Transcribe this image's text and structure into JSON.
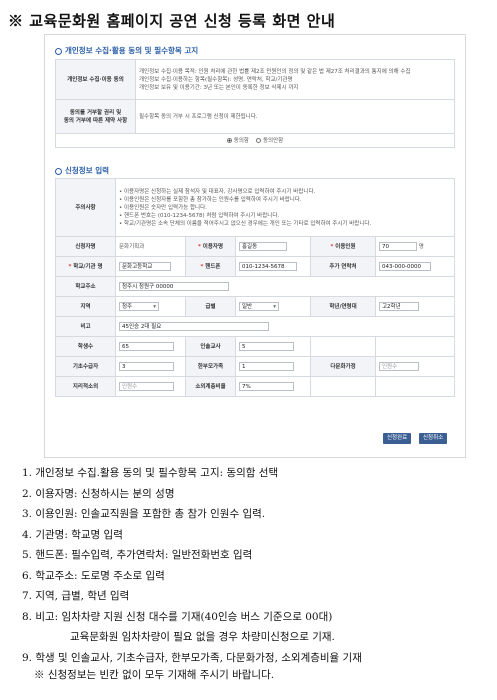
{
  "page_title": "※ 교육문화원 홈페이지 공연 신청 등록 화면 안내",
  "privacy": {
    "section_title": "개인정보 수집·활용 동의 및 필수항목 고지",
    "row1_label": "개인정보 수집·이용 동의",
    "row1_lines": [
      "개인정보 수집·이용 목적: 인원 처리에 관한 법률 제2조 민원인의 정의 및 같은 법 제27조 처리결과의 통지에 의해 수집",
      "개인정보 수집·이용하는 항목(필수항목): 성명, 연락처, 학교/기관명",
      "개인정보 보유 및 이용기간: 3년 또는 본인이 동록한 정보 삭제시 까지"
    ],
    "row2_label_1": "동의를 거부할 권리 및",
    "row2_label_2": "동의 거부에 따른 제약 사항",
    "row2_text": "필수항목 동의 거부 시 프로그램 신청이 제한됩니다.",
    "agree": "동의함",
    "disagree": "동의안함"
  },
  "apply": {
    "section_title": "신청정보 입력",
    "notice_label": "주의사항",
    "notice_lines": [
      "이용자명은 신청하는 실제 참석자 및 대표자, 강사명으로 입력하여 주시기 바랍니다.",
      "이용인원은 신청자를 포함한 총 참가하는 인원수를 입력하여 주시기 바랍니다.",
      "이용인원은 숫자만 입력가능 합니다.",
      "핸드폰 번호는 (010-1234-5678) 처럼 입력하여 주시기 바랍니다.",
      "학교/기관명은 소속 단체의 이름을 적어주시고 없으신 경우에는 개인 또는 기타로 입력하여 주시기 바랍니다."
    ],
    "applicant_label": "신청자명",
    "applicant_value": "문화기획과",
    "user_label": "이용자명",
    "user_value": "홍길동",
    "people_label": "이용인원",
    "people_value": "70",
    "people_unit": "명",
    "school_label": "학교/기관 명",
    "school_value": "문화고등학교",
    "phone_label": "핸드폰",
    "phone_value": "010-1234-5678",
    "extra_contact_label": "추가 연락처",
    "extra_contact_value": "043-000-0000",
    "address_label": "학교주소",
    "address_value": "청주시 청원구 00000",
    "region_label": "지역",
    "region_value": "청주",
    "level_label": "급별",
    "level_value": "일반",
    "grade_label": "학년/연령대",
    "grade_value": "고2학년",
    "note_label": "비고",
    "note_value": "45인승 2대 필요",
    "students_label": "학생수",
    "students_value": "65",
    "teachers_label": "인솔교사",
    "teachers_value": "5",
    "basic_label": "기초수급자",
    "basic_value": "3",
    "single_label": "한부모가족",
    "single_value": "1",
    "multi_label": "다문화가정",
    "multi_placeholder": "인원수",
    "local_label": "지리적소외",
    "local_placeholder": "인원수",
    "low_label": "소외계층비율",
    "low_value": "7%",
    "btn_complete": "신청완료",
    "btn_cancel": "신청취소"
  },
  "guide": [
    "1. 개인정보 수집.활용 동의 및 필수항목 고지: 동의함 선택",
    "2. 이용자명: 신청하시는 분의 성명",
    "3. 이용인원: 인솔교직원을 포함한 총 참가 인원수 입력.",
    "4. 기관명: 학교명 입력",
    "5. 핸드폰: 필수입력, 추가연락처: 일반전화번호 입력",
    "6. 학교주소: 도로명 주소로 입력",
    "7. 지역, 급별, 학년 입력",
    "8. 비고: 임차차량 지원 신청 대수를 기재(40인승 버스 기준으로 00대)",
    "교육문화원 임차차량이 필요 없을 경우 차량미신청으로 기재.",
    "9. 학생 및 인솔교사, 기초수급자, 한부모가족, 다문화가정, 소외계층비율 기재",
    "※ 신청정보는 빈칸 없이 모두 기재해 주시기 바랍니다."
  ]
}
